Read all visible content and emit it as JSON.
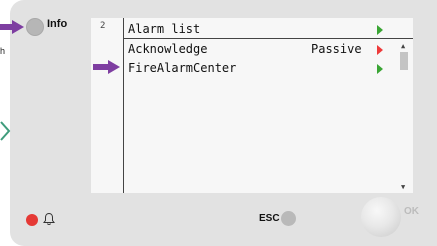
{
  "device": {
    "side_text": "h",
    "info_label": "Info",
    "esc_label": "ESC",
    "ok_label": "OK"
  },
  "screen": {
    "gutter_number": "2",
    "title": "Alarm list",
    "rows": [
      {
        "name": "Acknowledge",
        "value": "Passive",
        "indicator_color": "#ee3a3a"
      },
      {
        "name": "FireAlarmCenter",
        "value": "",
        "indicator_color": "#3aa534"
      }
    ],
    "title_indicator_color": "#3aa534"
  },
  "colors": {
    "arrow": "#7e3ea1",
    "chevron": "#3f9c7c",
    "alarm_led": "#e53935"
  },
  "icons": [
    "bell-icon",
    "right-arrow-icon",
    "chevron-right-icon",
    "scroll-up-icon",
    "scroll-down-icon"
  ]
}
